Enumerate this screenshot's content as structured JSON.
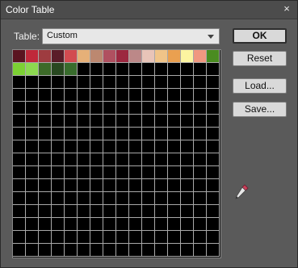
{
  "dialog": {
    "title": "Color Table",
    "close_glyph": "×"
  },
  "table_select": {
    "label": "Table:",
    "value": "Custom"
  },
  "buttons": {
    "ok": "OK",
    "reset": "Reset",
    "load": "Load...",
    "save": "Save..."
  },
  "swatches": [
    "#5a1420",
    "#c0283a",
    "#9e3c40",
    "#5a1c28",
    "#d24a50",
    "#e6b078",
    "#bc8870",
    "#b05060",
    "#9c2840",
    "#bc8888",
    "#e8c4b8",
    "#f0c488",
    "#eaa050",
    "#fcf4a0",
    "#f09880",
    "#4a8c20",
    "#7cd034",
    "#8cd850",
    "#3c6a28",
    "#284820",
    "#386c2c"
  ],
  "empty_swatch_color": "#000000",
  "grid_cells": 256,
  "icons": {
    "eyedropper": "eyedropper-icon"
  }
}
